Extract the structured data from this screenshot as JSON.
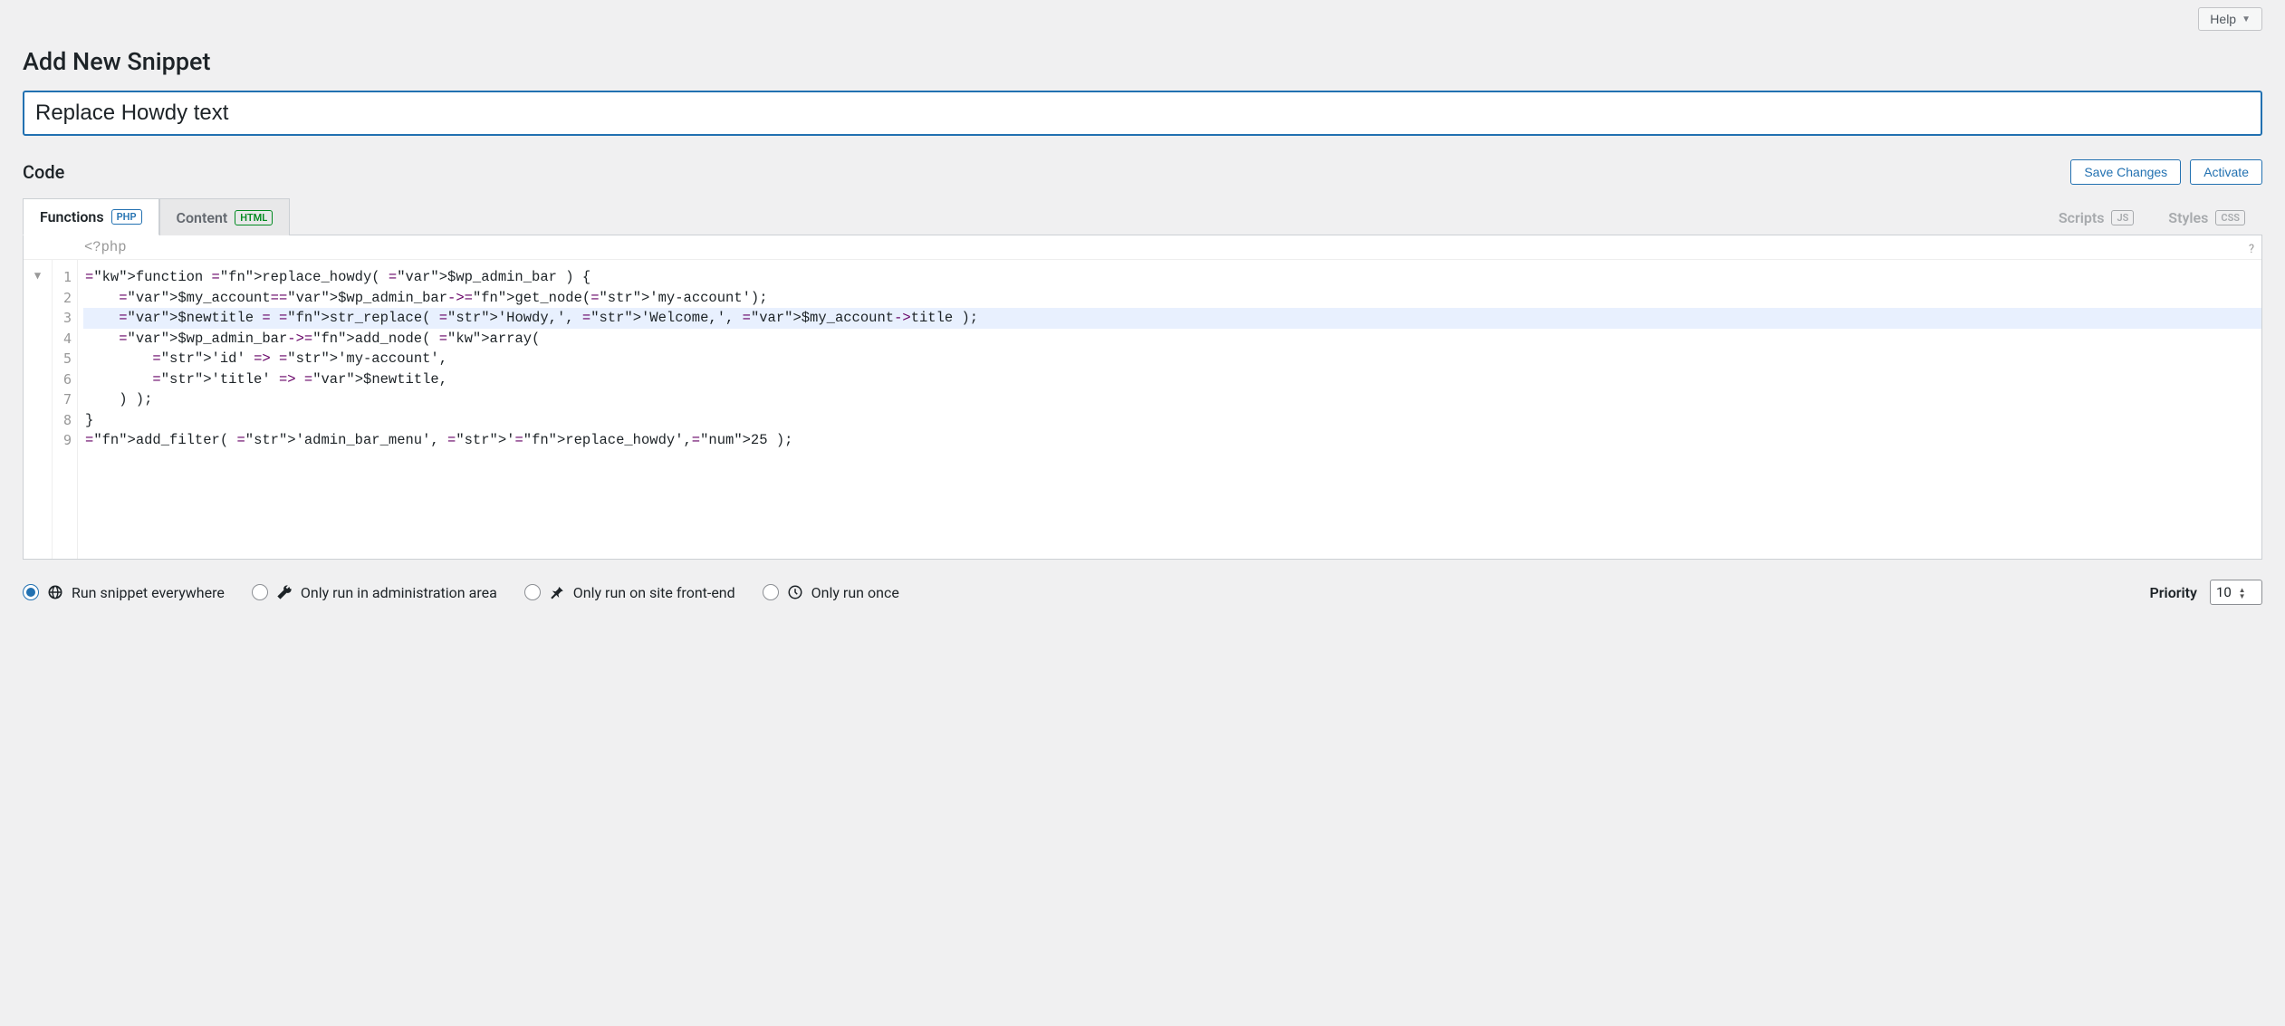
{
  "header": {
    "help": "Help",
    "page_title": "Add New Snippet"
  },
  "title_input": {
    "value": "Replace Howdy text",
    "placeholder": ""
  },
  "section": {
    "label": "Code",
    "save": "Save Changes",
    "activate": "Activate"
  },
  "tabs": {
    "functions": {
      "label": "Functions",
      "badge": "PHP"
    },
    "content": {
      "label": "Content",
      "badge": "HTML"
    },
    "scripts": {
      "label": "Scripts",
      "badge": "JS"
    },
    "styles": {
      "label": "Styles",
      "badge": "CSS"
    }
  },
  "editor": {
    "prelude": "<?php",
    "lines": [
      "function replace_howdy( $wp_admin_bar ) {",
      "    $my_account=$wp_admin_bar->get_node('my-account');",
      "    $newtitle = str_replace( 'Howdy,', 'Welcome,', $my_account->title );",
      "    $wp_admin_bar->add_node( array(",
      "        'id' => 'my-account',",
      "        'title' => $newtitle,",
      "    ) );",
      "}",
      "add_filter( 'admin_bar_menu', 'replace_howdy',25 );"
    ],
    "highlighted_line_index": 2,
    "fold_marker": "▼",
    "help_icon": "?"
  },
  "run_options": {
    "everywhere": "Run snippet everywhere",
    "admin": "Only run in administration area",
    "frontend": "Only run on site front-end",
    "once": "Only run once",
    "selected": "everywhere"
  },
  "priority": {
    "label": "Priority",
    "value": "10"
  }
}
